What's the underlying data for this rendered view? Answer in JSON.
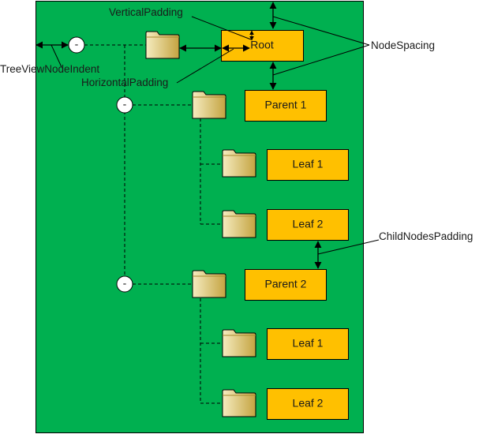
{
  "colors": {
    "panel": "#00b050",
    "node": "#ffc000",
    "folder_light": "#f5ecc0",
    "folder_dark": "#c8a846"
  },
  "labels": {
    "vertical_padding": "VerticalPadding",
    "node_spacing": "NodeSpacing",
    "tree_view_node_indent": "TreeViewNodeIndent",
    "horizontal_padding": "HorizontalPadding",
    "child_nodes_padding": "ChildNodesPadding"
  },
  "expander_symbol": "-",
  "nodes": {
    "root": "Root",
    "parent1": "Parent 1",
    "p1_leaf1": "Leaf 1",
    "p1_leaf2": "Leaf 2",
    "parent2": "Parent 2",
    "p2_leaf1": "Leaf 1",
    "p2_leaf2": "Leaf 2"
  }
}
